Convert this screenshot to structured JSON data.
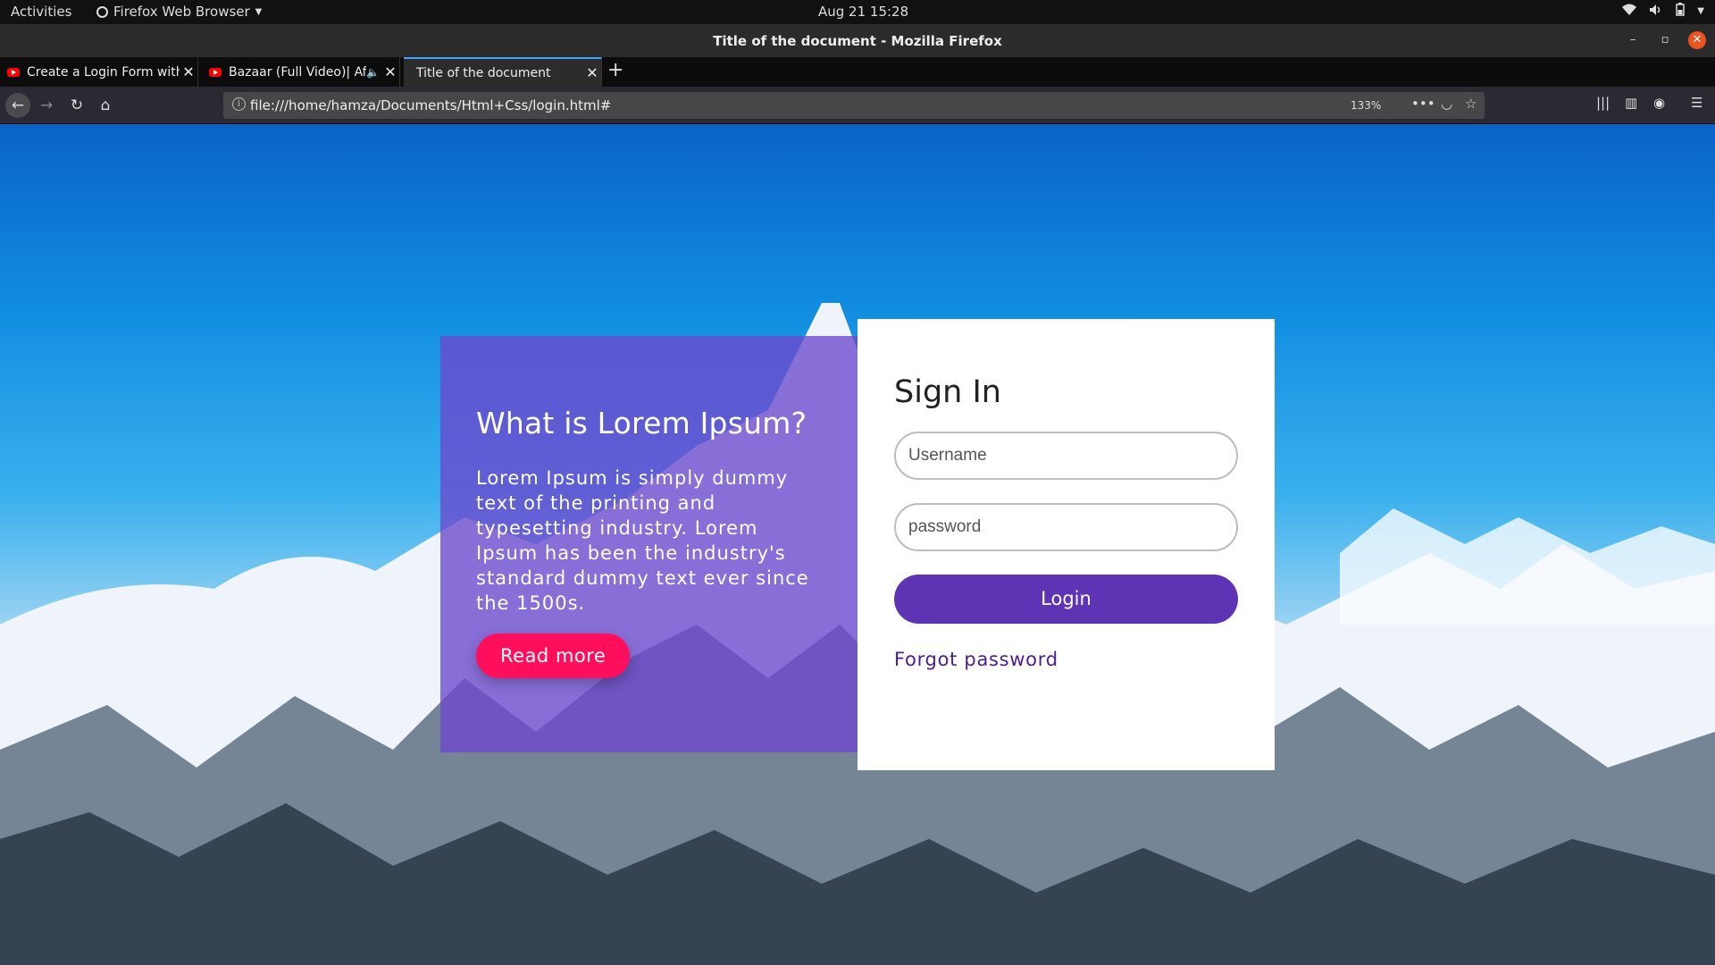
{
  "system_bar": {
    "activities": "Activities",
    "app_menu": "Firefox Web Browser",
    "clock": "Aug 21  15:28"
  },
  "window": {
    "title": "Title of the document - Mozilla Firefox"
  },
  "tabs": [
    {
      "label": "Create a Login Form with",
      "favicon": "youtube-icon",
      "active": false
    },
    {
      "label": "Bazaar (Full Video)| Af",
      "favicon": "youtube-icon",
      "audio": true,
      "active": false
    },
    {
      "label": "Title of the document",
      "active": true
    }
  ],
  "navbar": {
    "url": "file:///home/hamza/Documents/Html+Css/login.html#",
    "zoom": "133%"
  },
  "page": {
    "info": {
      "heading": "What is Lorem Ipsum?",
      "body": "Lorem Ipsum is simply dummy text of the printing and typesetting industry. Lorem Ipsum has been the industry's standard dummy text ever since the 1500s.",
      "button": "Read more"
    },
    "signin": {
      "heading": "Sign In",
      "username_placeholder": "Username",
      "password_placeholder": "password",
      "login_button": "Login",
      "forgot_link": "Forgot password"
    }
  },
  "colors": {
    "panel_purple": "#6c48cd",
    "read_more_pink": "#ff0f5b",
    "login_purple": "#5f34b4",
    "link_purple": "#4a1d92",
    "firefox_close": "#e95420"
  }
}
